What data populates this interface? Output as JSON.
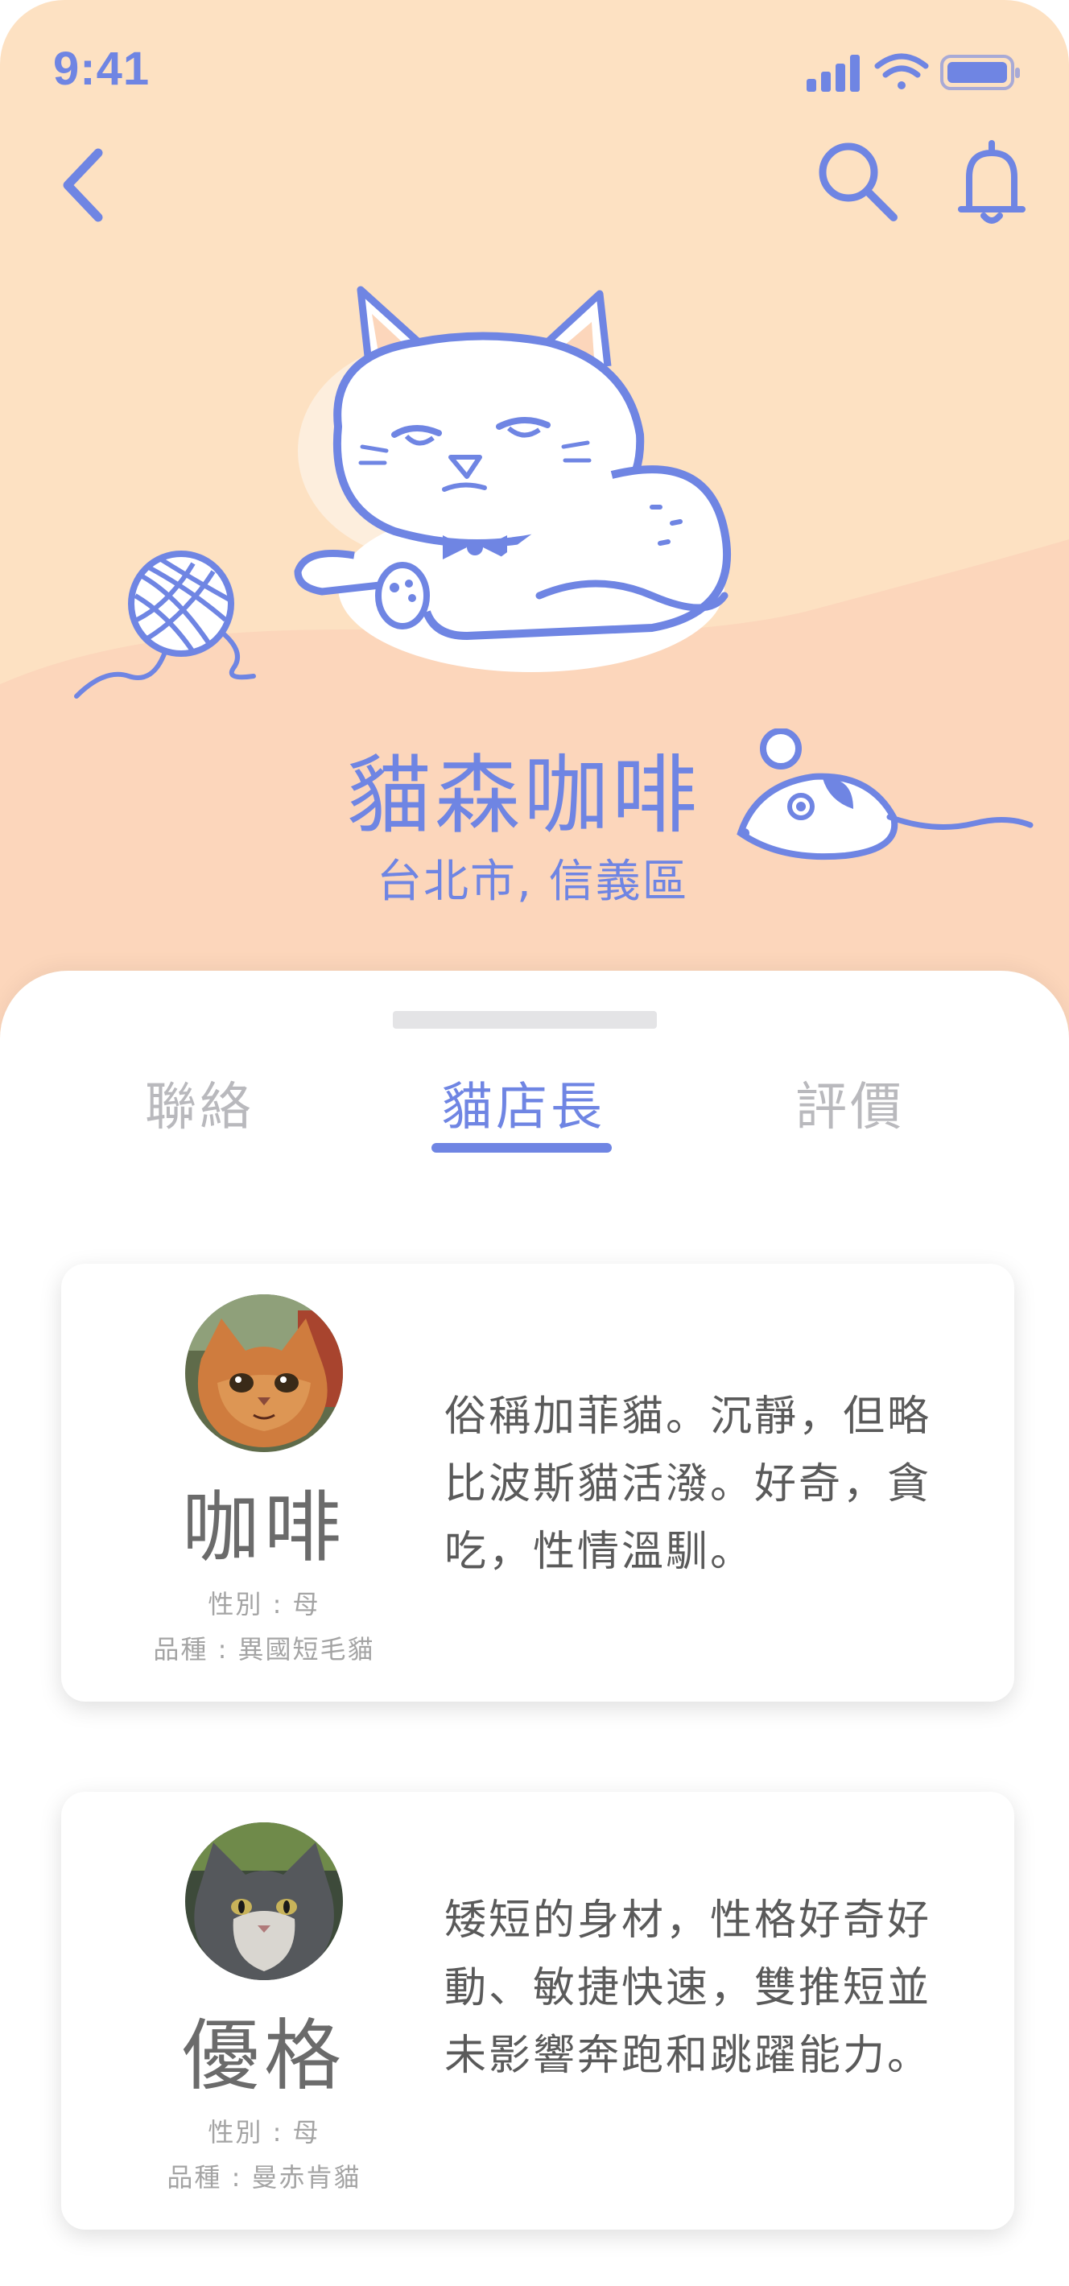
{
  "status_bar": {
    "time": "9:41",
    "icons": [
      "signal-bars-icon",
      "wifi-icon",
      "battery-icon"
    ]
  },
  "nav": {
    "back_icon": "chevron-left-icon",
    "search_icon": "search-icon",
    "notification_icon": "bell-icon"
  },
  "hero": {
    "shop_name": "貓森咖啡",
    "location": "台北市, 信義區",
    "illustrations": [
      "cat-illustration",
      "yarn-ball-illustration",
      "mouse-toy-illustration"
    ]
  },
  "tabs": [
    {
      "label": "聯絡",
      "active": false
    },
    {
      "label": "貓店長",
      "active": true
    },
    {
      "label": "評價",
      "active": false
    }
  ],
  "cats": [
    {
      "name": "咖啡",
      "gender": "性別 : 母",
      "breed": "品種 : 異國短毛貓",
      "description": "俗稱加菲貓。沉靜，但略比波斯貓活潑。好奇，貪吃，性情溫馴。"
    },
    {
      "name": "優格",
      "gender": "性別 : 母",
      "breed": "品種 : 曼赤肯貓",
      "description": "矮短的身材，性格好奇好動、敏捷快速，雙推短並未影響奔跑和跳躍能力。"
    }
  ],
  "colors": {
    "accent": "#6f85e3",
    "hero_bg": "#fde1c2",
    "hero_bg_lower": "#fcd6bb",
    "tab_inactive": "#b9b9bd",
    "text_dark": "#5a5a5a",
    "text_muted": "#a4a4a4"
  }
}
